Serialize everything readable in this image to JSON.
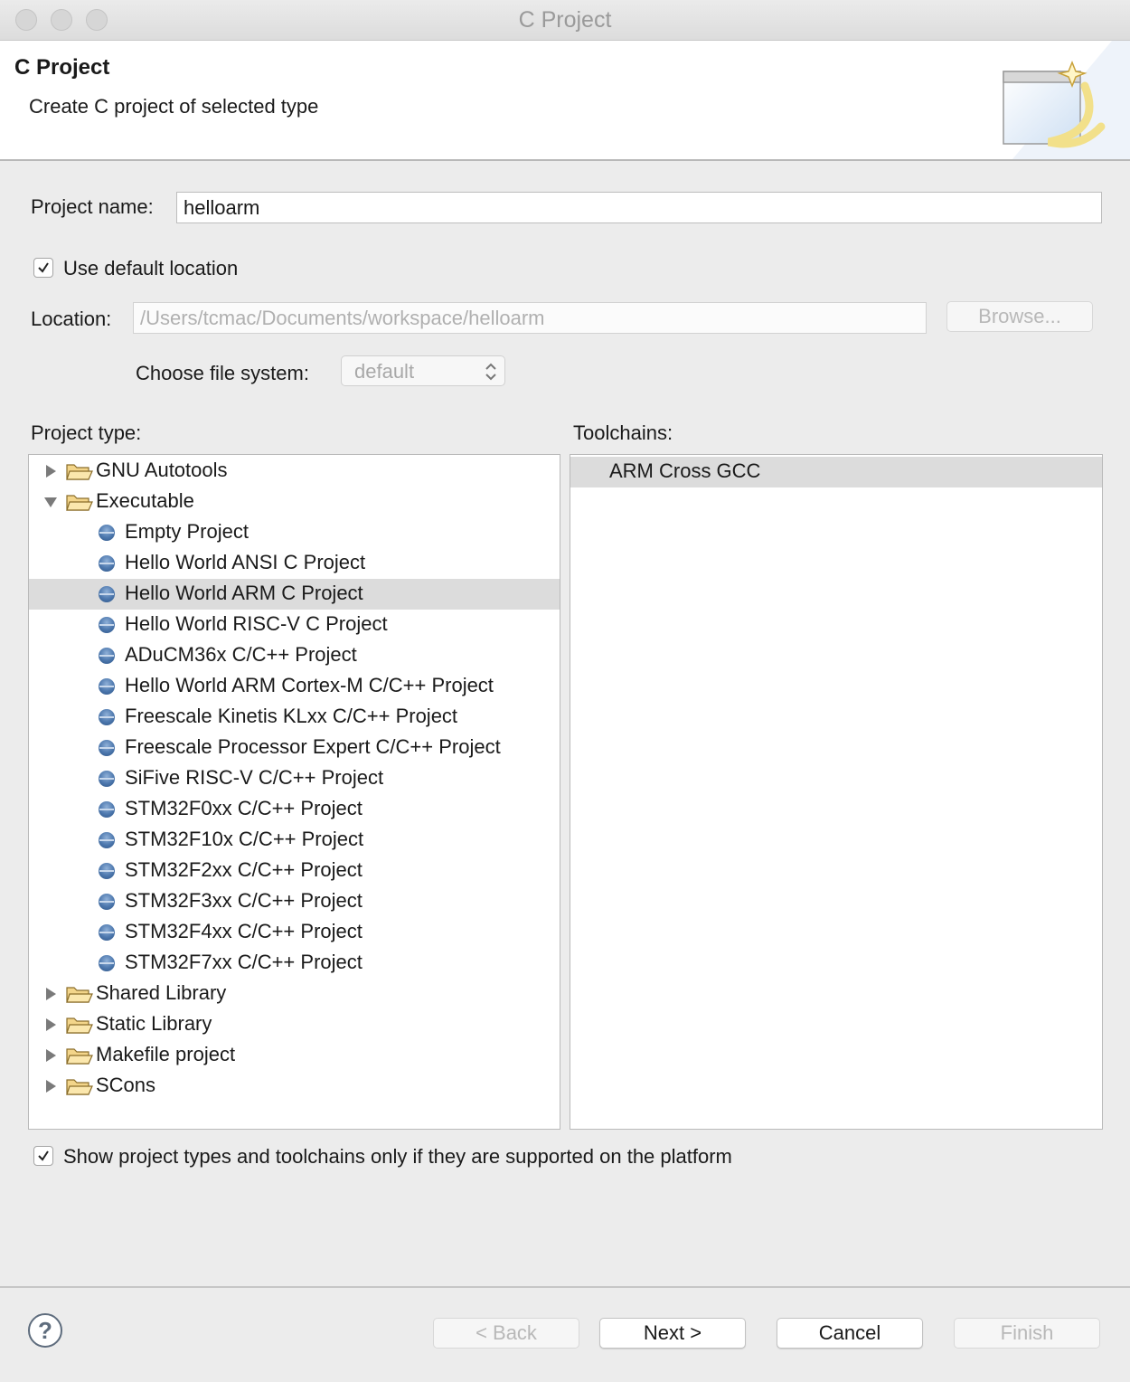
{
  "window": {
    "title": "C Project"
  },
  "header": {
    "title": "C Project",
    "description": "Create C project of selected type"
  },
  "project_name": {
    "label": "Project name:",
    "value": "helloarm"
  },
  "use_default_location": {
    "label": "Use default location",
    "checked": true
  },
  "location": {
    "label": "Location:",
    "value": "/Users/tcmac/Documents/workspace/helloarm",
    "browse_label": "Browse..."
  },
  "file_system": {
    "label": "Choose file system:",
    "value": "default"
  },
  "project_type": {
    "label": "Project type:",
    "items": [
      {
        "label": "GNU Autotools",
        "kind": "folder",
        "expanded": false
      },
      {
        "label": "Executable",
        "kind": "folder",
        "expanded": true
      },
      {
        "label": "Empty Project",
        "kind": "item"
      },
      {
        "label": "Hello World ANSI C Project",
        "kind": "item"
      },
      {
        "label": "Hello World ARM C Project",
        "kind": "item",
        "selected": true
      },
      {
        "label": "Hello World RISC-V C Project",
        "kind": "item"
      },
      {
        "label": "ADuCM36x C/C++ Project",
        "kind": "item"
      },
      {
        "label": "Hello World ARM Cortex-M C/C++ Project",
        "kind": "item"
      },
      {
        "label": "Freescale Kinetis KLxx C/C++ Project",
        "kind": "item"
      },
      {
        "label": "Freescale Processor Expert C/C++ Project",
        "kind": "item"
      },
      {
        "label": "SiFive RISC-V C/C++ Project",
        "kind": "item"
      },
      {
        "label": "STM32F0xx C/C++ Project",
        "kind": "item"
      },
      {
        "label": "STM32F10x C/C++ Project",
        "kind": "item"
      },
      {
        "label": "STM32F2xx C/C++ Project",
        "kind": "item"
      },
      {
        "label": "STM32F3xx C/C++ Project",
        "kind": "item"
      },
      {
        "label": "STM32F4xx C/C++ Project",
        "kind": "item"
      },
      {
        "label": "STM32F7xx C/C++ Project",
        "kind": "item"
      },
      {
        "label": "Shared Library",
        "kind": "folder",
        "expanded": false
      },
      {
        "label": "Static Library",
        "kind": "folder",
        "expanded": false
      },
      {
        "label": "Makefile project",
        "kind": "folder",
        "expanded": false
      },
      {
        "label": "SCons",
        "kind": "folder",
        "expanded": false
      }
    ]
  },
  "toolchains": {
    "label": "Toolchains:",
    "items": [
      {
        "label": "ARM Cross GCC",
        "selected": true
      }
    ]
  },
  "show_supported": {
    "label": "Show project types and toolchains only if they are supported on the platform",
    "checked": true
  },
  "footer": {
    "help": "?",
    "back": "< Back",
    "next": "Next >",
    "cancel": "Cancel",
    "finish": "Finish"
  },
  "colors": {
    "selection": "#dcdcdc",
    "window_bg": "#ececec",
    "bullet": "#4c77ad"
  }
}
